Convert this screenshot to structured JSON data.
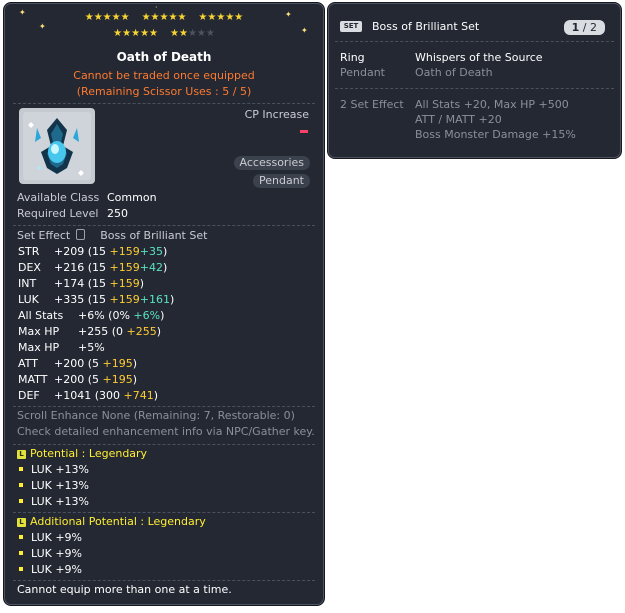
{
  "item": {
    "name": "Oath of Death",
    "trade_note": "Cannot be traded once equipped",
    "scissor_note": "(Remaining Scissor Uses : 5 / 5)",
    "cp_label": "CP Increase",
    "category": "Accessories",
    "subcategory": "Pendant",
    "stars_filled": 22,
    "stars_total": 25,
    "info": {
      "class_label": "Available Class",
      "class_value": "Common",
      "level_label": "Required Level",
      "level_value": "250",
      "set_label": "Set Effect",
      "set_value": "Boss of Brilliant Set"
    },
    "stats": [
      {
        "name": "STR",
        "total": "+209",
        "open": "(15",
        "bonus": "+159",
        "extra": "+35",
        "close": ")"
      },
      {
        "name": "DEX",
        "total": "+216",
        "open": "(15",
        "bonus": "+159",
        "extra": "+42",
        "close": ")"
      },
      {
        "name": "INT",
        "total": "+174",
        "open": "(15",
        "bonus": "+159",
        "extra": "",
        "close": ")"
      },
      {
        "name": "LUK",
        "total": "+335",
        "open": "(15",
        "bonus": "+159",
        "extra": "+161",
        "close": ")"
      },
      {
        "name": "All Stats",
        "total": "+6%",
        "open": "(0%",
        "bonus": "",
        "extra": "+6%",
        "close": ")"
      },
      {
        "name": "Max HP",
        "total": "+255",
        "open": "(0",
        "bonus": "+255",
        "extra": "",
        "close": ")"
      },
      {
        "name": "Max HP",
        "total": "+5%",
        "open": "",
        "bonus": "",
        "extra": "",
        "close": ""
      },
      {
        "name": "ATT",
        "total": "+200",
        "open": "(5",
        "bonus": "+195",
        "extra": "",
        "close": ")"
      },
      {
        "name": "MATT",
        "total": "+200",
        "open": "(5",
        "bonus": "+195",
        "extra": "",
        "close": ")"
      },
      {
        "name": "DEF",
        "total": "+1041",
        "open": "(300",
        "bonus": "+741",
        "extra": "",
        "close": ")"
      }
    ],
    "scroll_line": "Scroll Enhance None (Remaining: 7, Restorable: 0)",
    "check_line": "Check detailed enhancement info via NPC/Gather key.",
    "potential": {
      "badge": "L",
      "header": "Potential : Legendary",
      "lines": [
        "LUK +13%",
        "LUK +13%",
        "LUK +13%"
      ]
    },
    "additional_potential": {
      "badge": "L",
      "header": "Additional Potential : Legendary",
      "lines": [
        "LUK +9%",
        "LUK +9%",
        "LUK +9%"
      ]
    },
    "footer": "Cannot equip more than one at a time."
  },
  "set_panel": {
    "badge": "SET",
    "title": "Boss of Brilliant Set",
    "page_current": "1",
    "page_sep": "/",
    "page_total": "2",
    "pieces": [
      {
        "slot": "Ring",
        "name": "Whispers of the Source",
        "equipped": true
      },
      {
        "slot": "Pendant",
        "name": "Oath of Death",
        "equipped": false
      }
    ],
    "effect_label": "2 Set Effect",
    "effects": [
      "All Stats  +20, Max HP  +500",
      "ATT / MATT  +20",
      "Boss Monster Damage +15%"
    ]
  },
  "colors": {
    "panel_bg": "#232833",
    "star": "#f8d433",
    "warning": "#ff7a2f",
    "bonus_yellow": "#ffcc33",
    "bonus_cyan": "#5be3c1",
    "potential": "#ffee33"
  }
}
